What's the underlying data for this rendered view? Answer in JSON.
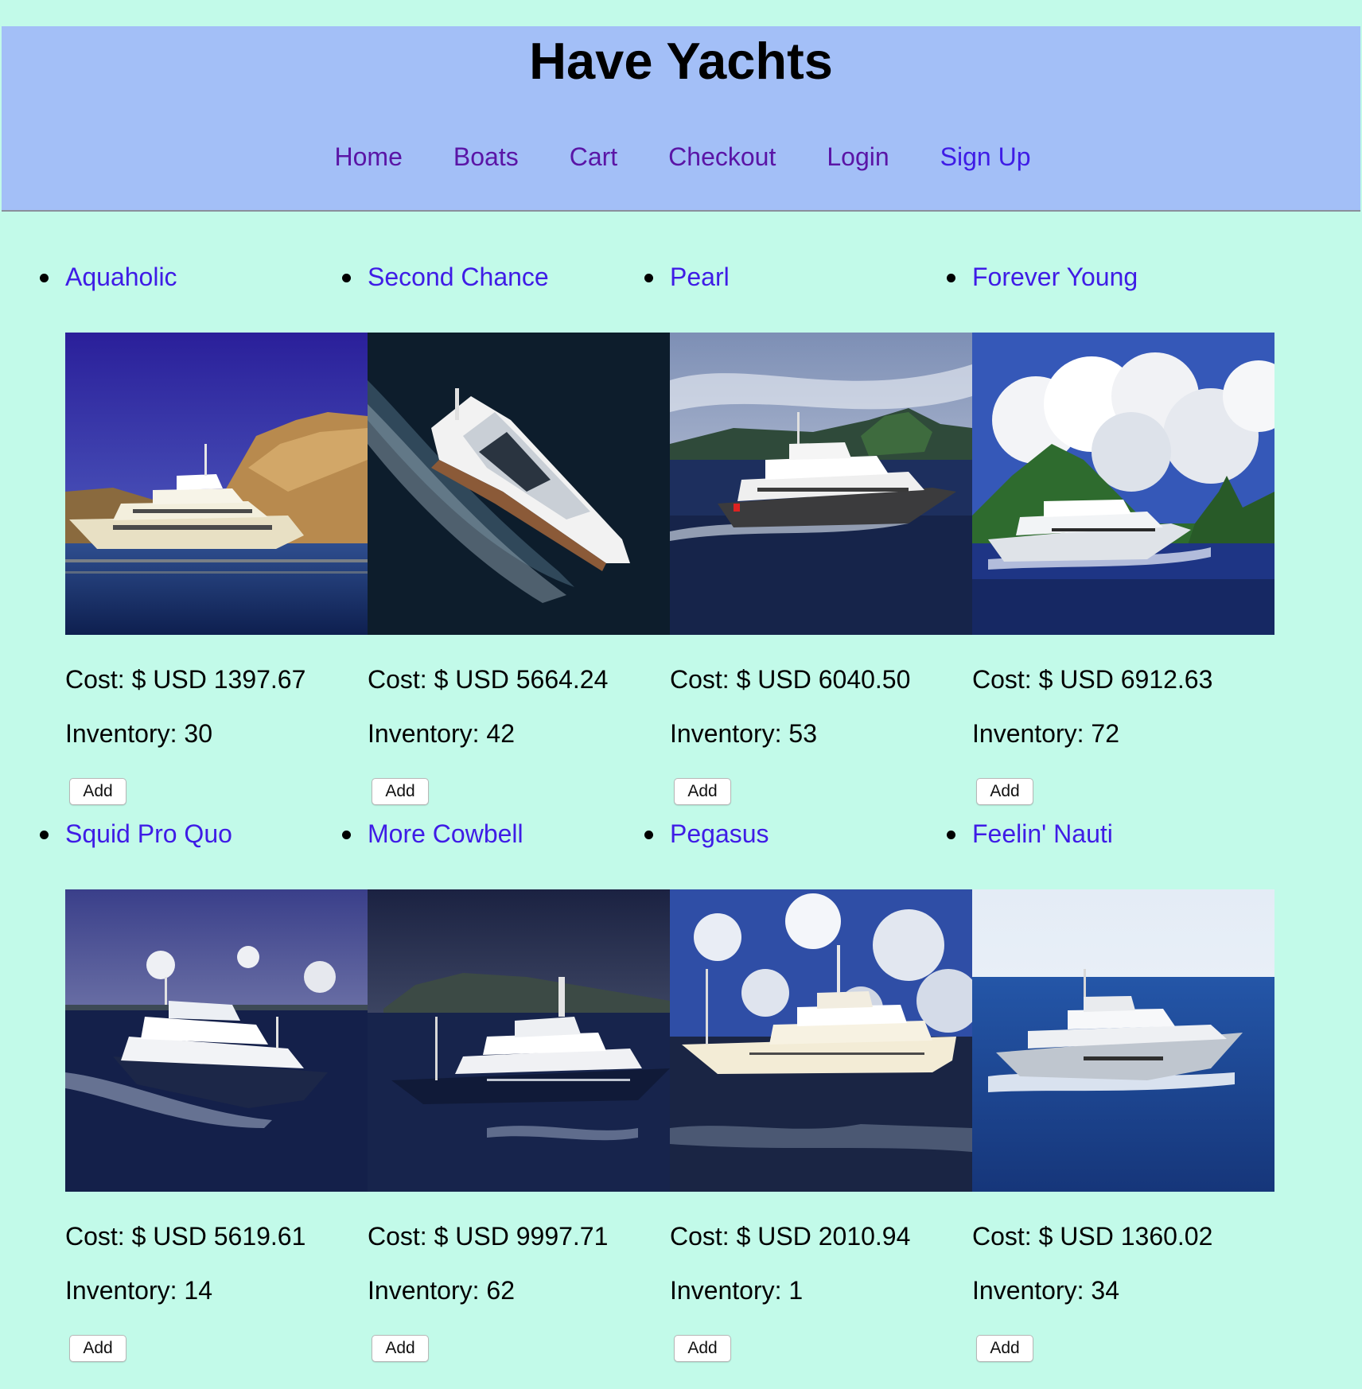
{
  "site": {
    "title": "Have Yachts"
  },
  "nav": [
    {
      "label": "Home",
      "state": "visited"
    },
    {
      "label": "Boats",
      "state": "visited"
    },
    {
      "label": "Cart",
      "state": "visited"
    },
    {
      "label": "Checkout",
      "state": "visited"
    },
    {
      "label": "Login",
      "state": "visited"
    },
    {
      "label": "Sign Up",
      "state": "link"
    }
  ],
  "products": [
    {
      "name": "Aquaholic",
      "cost": "Cost: $ USD 1397.67",
      "inventory": "Inventory: 30",
      "add_label": "Add",
      "photo": "yacht-photo"
    },
    {
      "name": "Second Chance",
      "cost": "Cost: $ USD 5664.24",
      "inventory": "Inventory: 42",
      "add_label": "Add",
      "photo": "yacht-photo"
    },
    {
      "name": "Pearl",
      "cost": "Cost: $ USD 6040.50",
      "inventory": "Inventory: 53",
      "add_label": "Add",
      "photo": "yacht-photo"
    },
    {
      "name": "Forever Young",
      "cost": "Cost: $ USD 6912.63",
      "inventory": "Inventory: 72",
      "add_label": "Add",
      "photo": "yacht-photo"
    },
    {
      "name": "Squid Pro Quo",
      "cost": "Cost: $ USD 5619.61",
      "inventory": "Inventory: 14",
      "add_label": "Add",
      "photo": "yacht-photo"
    },
    {
      "name": "More Cowbell",
      "cost": "Cost: $ USD 9997.71",
      "inventory": "Inventory: 62",
      "add_label": "Add",
      "photo": "yacht-photo"
    },
    {
      "name": "Pegasus",
      "cost": "Cost: $ USD 2010.94",
      "inventory": "Inventory: 1",
      "add_label": "Add",
      "photo": "yacht-photo"
    },
    {
      "name": "Feelin' Nauti",
      "cost": "Cost: $ USD 1360.02",
      "inventory": "Inventory: 34",
      "add_label": "Add",
      "photo": "yacht-photo"
    }
  ],
  "colors": {
    "page_background": "#c2fae9",
    "header_background": "#a3bff7",
    "link": "#3f1ce6",
    "visited_link": "#5a15a6"
  }
}
